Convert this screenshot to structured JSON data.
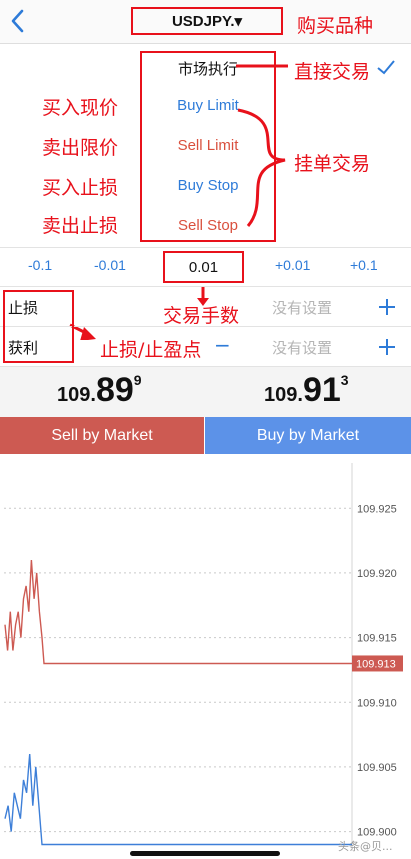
{
  "header": {
    "symbol": "USDJPY.▾"
  },
  "annotations": {
    "symbol_note": "购买品种",
    "market_note": "直接交易",
    "buy_limit_note": "买入现价",
    "sell_limit_note": "卖出限价",
    "buy_stop_note": "买入止损",
    "sell_stop_note": "卖出止损",
    "pending_note": "挂单交易",
    "volume_note": "交易手数",
    "sltp_note": "止损/止盈点"
  },
  "order_types": {
    "market": "市场执行",
    "buy_limit": "Buy Limit",
    "sell_limit": "Sell Limit",
    "buy_stop": "Buy Stop",
    "sell_stop": "Sell Stop"
  },
  "volume": {
    "steps": [
      "-0.1",
      "-0.01",
      "+0.01",
      "+0.1"
    ],
    "value": "0.01"
  },
  "stop_loss": {
    "label": "止损",
    "value": "没有设置"
  },
  "take_profit": {
    "label": "获利",
    "value": "没有设置"
  },
  "prices": {
    "bid": {
      "small": "109.",
      "big": "89",
      "sup": "9"
    },
    "ask": {
      "small": "109.",
      "big": "91",
      "sup": "3"
    }
  },
  "buttons": {
    "sell": "Sell by Market",
    "buy": "Buy by Market"
  },
  "chart_data": {
    "type": "line",
    "y_ticks": [
      "109.925",
      "109.920",
      "109.915",
      "109.910",
      "109.905",
      "109.900"
    ],
    "ylim": [
      109.8985,
      109.9285
    ],
    "current_price_label": "109.913",
    "series": [
      {
        "color": "#cd5a52",
        "values": [
          109.916,
          109.914,
          109.917,
          109.914,
          109.916,
          109.917,
          109.915,
          109.918,
          109.919,
          109.917,
          109.921,
          109.918,
          109.92,
          109.917,
          109.915,
          109.913,
          109.913,
          109.913
        ]
      },
      {
        "color": "#3d7fd8",
        "values": [
          109.901,
          109.902,
          109.9,
          109.903,
          109.902,
          109.901,
          109.904,
          109.903,
          109.906,
          109.902,
          109.905,
          109.902,
          109.899,
          109.899,
          109.899,
          109.899
        ]
      }
    ],
    "grid": true
  },
  "colors": {
    "accent_red": "#e8111b",
    "link_blue": "#2e7bd8",
    "sell": "#cd5a52",
    "buy": "#5c92e8"
  },
  "watermark": "头条@贝..."
}
